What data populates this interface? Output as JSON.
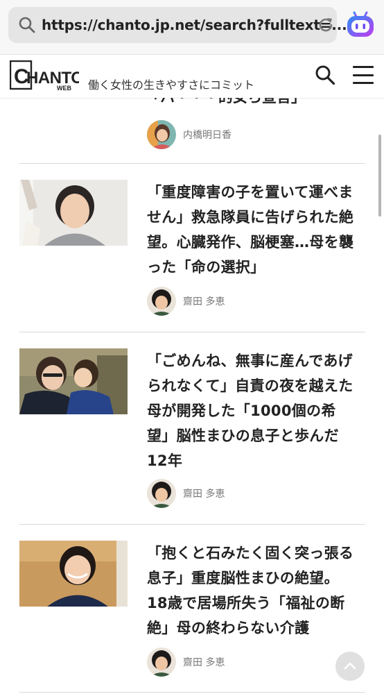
{
  "browser": {
    "url": "https://chanto.jp.net/search?fulltext=..."
  },
  "header": {
    "logo_text": "CHANTO",
    "logo_sub": "WEB",
    "tagline": "働く女性の生きやすさにコミット"
  },
  "previous_article": {
    "title_fragment": "「ハ・・・的女ら宣言」",
    "author": "内橋明日香"
  },
  "articles": [
    {
      "title_lines": [
        "「重度障害の子を置いて運べま",
        "せん」救急隊員に告げられた絶",
        "望。心臓発作、脳梗塞…母を襲",
        "った「命の選択」"
      ],
      "author": "齋田 多恵"
    },
    {
      "title_lines": [
        "「ごめんね、無事に産んであげ",
        "られなくて」自責の夜を越えた",
        "母が開発した「1000個の希",
        "望」脳性まひの息子と歩んだ",
        "12年"
      ],
      "author": "齋田 多恵"
    },
    {
      "title_lines": [
        "「抱くと石みたく固く突っ張る",
        "息子」重度脳性まひの絶望。",
        "18歳で居場所失う「福祉の断",
        "絶」母の終わらない介護"
      ],
      "author": "齋田 多恵"
    }
  ]
}
